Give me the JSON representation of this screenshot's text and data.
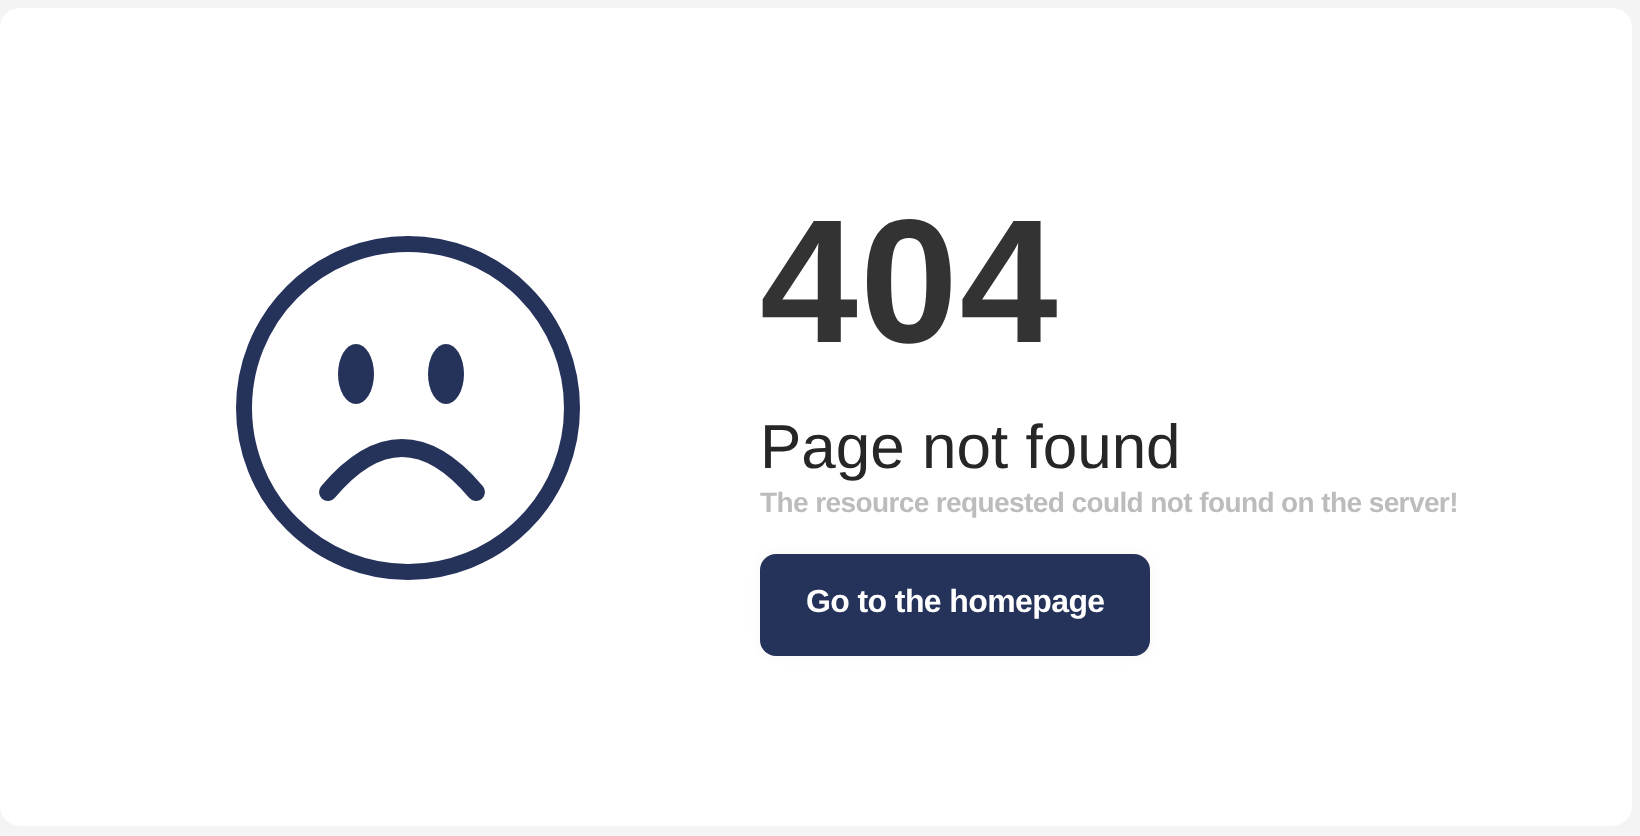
{
  "error": {
    "code": "404",
    "title": "Page not found",
    "message": "The resource requested could not found on the server!"
  },
  "button": {
    "label": "Go to the homepage"
  }
}
